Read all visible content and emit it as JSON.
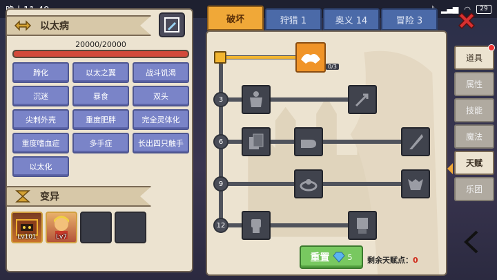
{
  "status_bar": {
    "time": "晚上11:49",
    "battery": "29"
  },
  "character": {
    "name": "以太病",
    "hp_text": "20000/20000",
    "hp_fraction": 1.0
  },
  "traits": [
    "蹄化",
    "以太之翼",
    "战斗饥渴",
    "沉迷",
    "暴食",
    "双头",
    "尖刺外壳",
    "重度肥胖",
    "完全灵体化",
    "重度嗜血症",
    "多手症",
    "长出四只触手",
    "以太化"
  ],
  "mutation": {
    "title": "变异",
    "slots": [
      {
        "level": "Lv101",
        "filled": true
      },
      {
        "level": "Lv7",
        "filled": true
      },
      {
        "level": "",
        "filled": false
      },
      {
        "level": "",
        "filled": false
      }
    ]
  },
  "tabs": [
    {
      "label": "破坏",
      "active": true
    },
    {
      "label": "狩猎 1",
      "active": false
    },
    {
      "label": "奥义 14",
      "active": false
    },
    {
      "label": "冒险 3",
      "active": false
    }
  ],
  "talent_board": {
    "active_node_count": "0/3",
    "row_labels": [
      "3",
      "6",
      "9",
      "12"
    ],
    "reset_label": "重置",
    "reset_cost": "5",
    "remaining_label": "剩余天赋点：",
    "remaining_value": "0"
  },
  "side_nav": [
    {
      "label": "道具",
      "notify": true
    },
    {
      "label": "属性",
      "notify": false
    },
    {
      "label": "技能",
      "notify": false
    },
    {
      "label": "魔法",
      "notify": false
    },
    {
      "label": "天赋",
      "notify": false,
      "active": true
    },
    {
      "label": "乐团",
      "notify": false
    }
  ],
  "colors": {
    "active_tab": "#f0a838",
    "inactive_tab": "#4b6aa8",
    "trait_button": "#7a84c8",
    "hp_bar": "#d34a3a",
    "reset_button": "#78c860",
    "panel": "#ece3d0"
  }
}
